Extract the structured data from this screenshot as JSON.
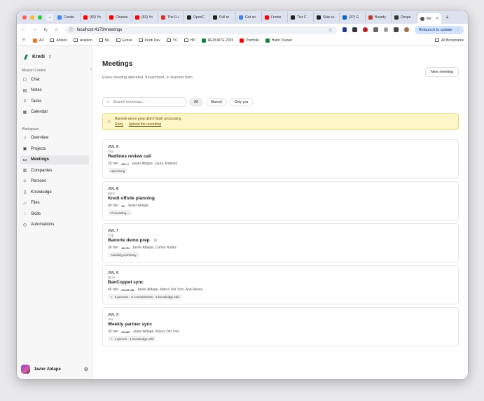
{
  "browser": {
    "tabs": [
      {
        "label": "Create",
        "icon": "google-icon",
        "color": "#4285f4"
      },
      {
        "label": "(83) Yo",
        "icon": "youtube-icon",
        "color": "#ff0000"
      },
      {
        "label": "Channe",
        "icon": "youtube-icon",
        "color": "#ff0000"
      },
      {
        "label": "(83) Yo",
        "icon": "youtube-icon",
        "color": "#ff0000"
      },
      {
        "label": "The Fu",
        "icon": "gmail-icon",
        "color": "#d93025"
      },
      {
        "label": "OpenC",
        "icon": "openc-icon",
        "color": "#222222"
      },
      {
        "label": "Pull re",
        "icon": "github-icon",
        "color": "#222222"
      },
      {
        "label": "Get an",
        "icon": "google-icon",
        "color": "#4285f4"
      },
      {
        "label": "Fronte",
        "icon": "youtube-icon",
        "color": "#ff0000"
      },
      {
        "label": "Tier C",
        "icon": "github-icon",
        "color": "#222222"
      },
      {
        "label": "Skip su",
        "icon": "github-icon",
        "color": "#222222"
      },
      {
        "label": "(37) G",
        "icon": "linkedin-icon",
        "color": "#0a66c2"
      },
      {
        "label": "Boardy",
        "icon": "boardy-icon",
        "color": "#c0392b"
      },
      {
        "label": "Despe",
        "icon": "globe-icon",
        "color": "#333333"
      }
    ],
    "active_tab": {
      "label": "Me",
      "close": "×"
    },
    "new_tab": "+",
    "url": "localhost:4173/meetings",
    "relaunch_label": "Relaunch to update",
    "bookmarks": [
      {
        "label": "AZ",
        "icon": "az-icon"
      },
      {
        "label": "Antaris",
        "icon": "folder-icon"
      },
      {
        "label": "Aviation",
        "icon": "folder-icon"
      },
      {
        "label": "ML",
        "icon": "folder-icon"
      },
      {
        "label": "Extras",
        "icon": "folder-icon"
      },
      {
        "label": "Kredi Dev",
        "icon": "folder-icon"
      },
      {
        "label": "YC",
        "icon": "folder-icon"
      },
      {
        "label": "HP",
        "icon": "folder-icon"
      },
      {
        "label": "REPORTE 2025",
        "icon": "sheets-icon"
      },
      {
        "label": "Portfolio",
        "icon": "youtube-icon"
      },
      {
        "label": "Habit Tracker",
        "icon": "sheets-icon"
      }
    ],
    "all_bookmarks": "All Bookmarks"
  },
  "sidebar": {
    "app_name": "Kredi",
    "mission_label": "Mission Control",
    "mission_items": [
      {
        "label": "Chat",
        "icon": "chat-icon"
      },
      {
        "label": "Notes",
        "icon": "notes-icon"
      },
      {
        "label": "Tasks",
        "icon": "tasks-icon"
      },
      {
        "label": "Calendar",
        "icon": "calendar-icon"
      }
    ],
    "workspace_label": "Workspace",
    "workspace_items": [
      {
        "label": "Overview",
        "icon": "home-icon"
      },
      {
        "label": "Projects",
        "icon": "projects-icon"
      },
      {
        "label": "Meetings",
        "icon": "video-icon",
        "active": true
      },
      {
        "label": "Companies",
        "icon": "companies-icon"
      },
      {
        "label": "Persons",
        "icon": "persons-icon"
      },
      {
        "label": "Knowledge",
        "icon": "book-icon"
      },
      {
        "label": "Files",
        "icon": "file-icon"
      },
      {
        "label": "Skills",
        "icon": "bulb-icon"
      },
      {
        "label": "Automations",
        "icon": "clock-icon"
      }
    ],
    "user_name": "Javier Aldape"
  },
  "main": {
    "title": "Meetings",
    "subtitle": "Every meeting attended, transcribed, or learned from.",
    "new_button": "New meeting",
    "search_placeholder": "Search meetings...",
    "filters": [
      "All",
      "Shared",
      "Only you"
    ],
    "alert": {
      "message": "Banorte demo prep didn't finish processing",
      "retry": "Retry",
      "sep": "·",
      "upload": "Upload the recording"
    },
    "meetings": [
      {
        "date": "JUL 9",
        "dow": "THU",
        "title": "Redlines review call",
        "duration": "20 min",
        "initials": "JA LJ",
        "people": "Javier Aldape, Laura Jiménez",
        "tag": "Upcoming",
        "locked": false
      },
      {
        "date": "JUL 8",
        "dow": "WED",
        "title": "Kredi offsite planning",
        "duration": "40 min",
        "initials": "JA",
        "people": "Javier Aldape",
        "tag": "Processing...",
        "locked": false
      },
      {
        "date": "JUL 7",
        "dow": "TUE",
        "title": "Banorte demo prep",
        "duration": "30 min",
        "initials": "JA CN",
        "people": "Javier Aldape, Carlos Nuñez",
        "tag": "Awaiting summary",
        "locked": true
      },
      {
        "date": "JUL 6",
        "dow": "MON",
        "title": "BanCoppel sync",
        "duration": "45 min",
        "initials": "JA MT AR",
        "people": "Javier Aldape, Marco Del Toro, Ana Reyes",
        "tag": "2 persons · 3 commitments · 1 knowledge edit",
        "locked": false,
        "tag_plus": true
      },
      {
        "date": "JUL 3",
        "dow": "FRI",
        "title": "Weekly partner sync",
        "duration": "30 min",
        "initials": "JA MD",
        "people": "Javier Aldape, Marco Del Toro",
        "tag": "1 person · 1 knowledge edit",
        "locked": false,
        "tag_plus": true
      }
    ]
  }
}
